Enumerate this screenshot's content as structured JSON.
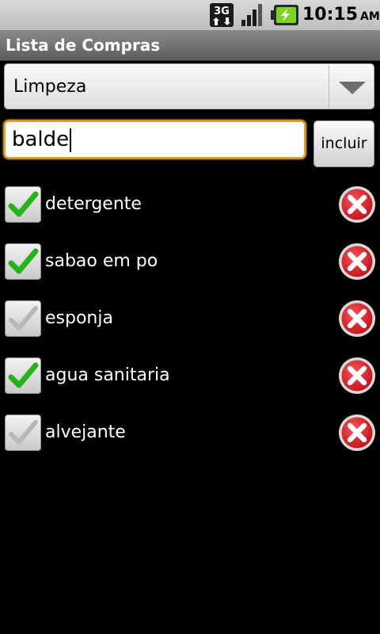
{
  "status_bar": {
    "network": "3G",
    "network_icon": "3g-icon",
    "signal_icon": "signal-icon",
    "battery_icon": "battery-charging-icon",
    "time": "10:15",
    "ampm": "AM"
  },
  "title": "Lista de Compras",
  "category_spinner": {
    "value": "Limpeza",
    "arrow_icon": "chevron-down-icon"
  },
  "item_input": {
    "value": "balde"
  },
  "add_button": {
    "label": "incluir"
  },
  "colors": {
    "accent_focus": "#f2a019",
    "check_green": "#22b518",
    "delete_red": "#c8141d"
  },
  "items": [
    {
      "label": "detergente",
      "checked": true
    },
    {
      "label": "sabao em po",
      "checked": true
    },
    {
      "label": "esponja",
      "checked": false
    },
    {
      "label": "agua sanitaria",
      "checked": true
    },
    {
      "label": "alvejante",
      "checked": false
    }
  ]
}
